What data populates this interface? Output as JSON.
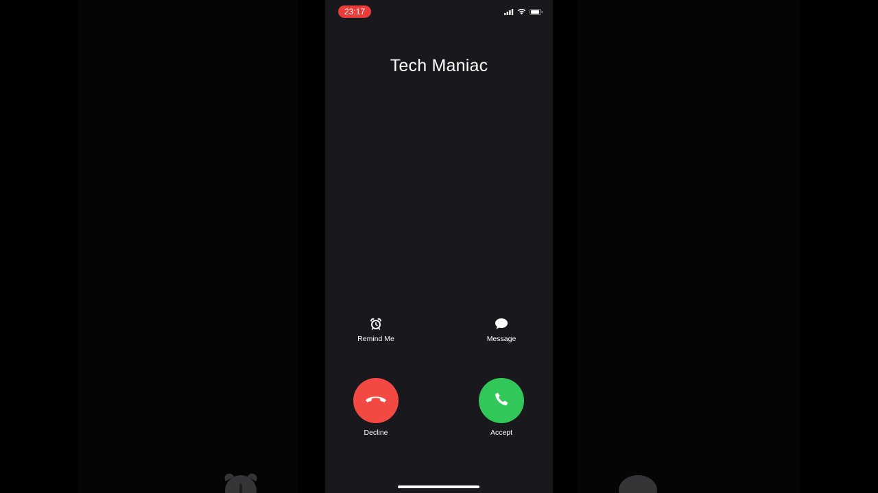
{
  "status_bar": {
    "time": "23:17",
    "time_pill_color": "#eb3c3a",
    "icons": [
      "cellular-signal-icon",
      "wifi-icon",
      "battery-icon"
    ]
  },
  "caller": {
    "name": "Tech Maniac"
  },
  "actions": {
    "remind_me": {
      "label": "Remind Me",
      "icon": "alarm-clock-icon"
    },
    "message": {
      "label": "Message",
      "icon": "speech-bubble-icon"
    }
  },
  "call_buttons": {
    "decline": {
      "label": "Decline",
      "color": "#f24943",
      "icon": "phone-hangup-icon"
    },
    "accept": {
      "label": "Accept",
      "color": "#31c859",
      "icon": "phone-icon"
    }
  }
}
